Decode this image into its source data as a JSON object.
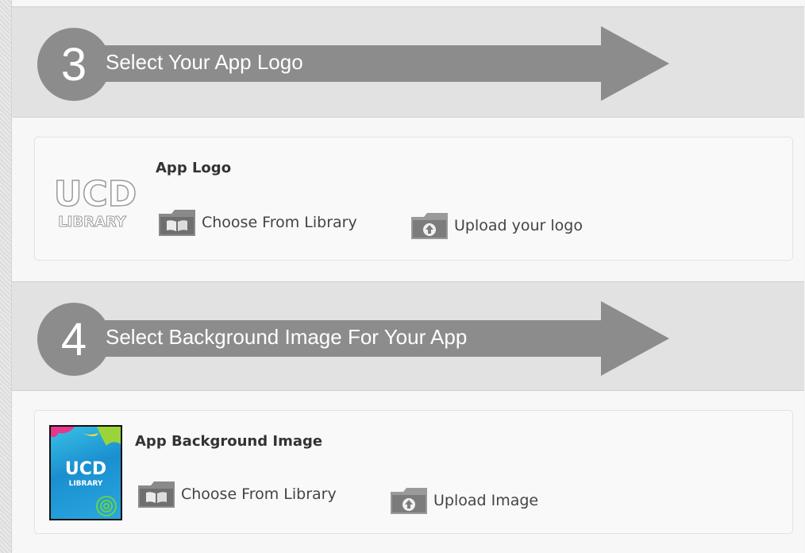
{
  "steps": [
    {
      "number": "3",
      "title": "Select Your App Logo"
    },
    {
      "number": "4",
      "title": "Select Background Image For Your App"
    }
  ],
  "logo_card": {
    "heading": "App Logo",
    "choose_label": "Choose From Library",
    "upload_label": "Upload your logo",
    "thumbnail": {
      "line1": "UCD",
      "line2": "LIBRARY"
    }
  },
  "background_card": {
    "heading": "App Background Image",
    "choose_label": "Choose From Library",
    "upload_label": "Upload Image",
    "thumbnail": {
      "line1": "UCD",
      "line2": "LIBRARY"
    }
  },
  "colors": {
    "step_badge": "#8c8c8c",
    "header_band": "#e2e2e2",
    "card_bg": "#f9f9f9"
  },
  "icons": [
    "library-book-icon",
    "upload-folder-icon"
  ]
}
